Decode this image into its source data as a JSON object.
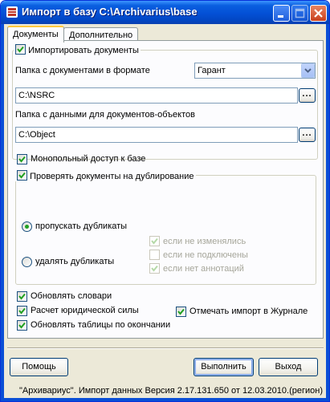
{
  "window": {
    "title": "Импорт в базу C:\\Archivarius\\base"
  },
  "tabs": [
    {
      "label": "Документы"
    },
    {
      "label": "Дополнительно"
    }
  ],
  "import_docs": {
    "label": "Импортировать документы",
    "checked": true
  },
  "folder_format": {
    "label": "Папка с документами в формате",
    "selected": "Гарант"
  },
  "docs_path": {
    "value": "C:\\NSRC",
    "browse_label": "..."
  },
  "objects_folder": {
    "label": "Папка с данными для документов-объектов",
    "value": "C:\\Object",
    "browse_label": "..."
  },
  "exclusive_access": {
    "label": "Монопольный доступ к базе",
    "checked": true
  },
  "duplicates": {
    "label": "Проверять документы на дублирование",
    "checked": true,
    "skip_label": "пропускать дубликаты",
    "delete_label": "удалять дубликаты",
    "options": [
      {
        "label": "если не изменялись",
        "checked": true
      },
      {
        "label": "если не подключены",
        "checked": false
      },
      {
        "label": "если нет аннотаций",
        "checked": true
      }
    ]
  },
  "update_dicts": {
    "label": "Обновлять словари",
    "checked": true
  },
  "legal_force": {
    "label": "Расчет юридической силы",
    "checked": true
  },
  "update_tables": {
    "label": "Обновлять таблицы по окончании",
    "checked": true
  },
  "journal": {
    "label": "Отмечать импорт в Журнале",
    "checked": true
  },
  "buttons": {
    "help": "Помощь",
    "run": "Выполнить",
    "exit": "Выход"
  },
  "status_text": "\"Архивариус\". Импорт данных Версия 2.17.131.650 от 12.03.2010.(регион)",
  "colors": {
    "titlebar": "#0350d6",
    "face": "#ece9d8",
    "panel": "#fcfcfe",
    "check": "#21a121"
  }
}
